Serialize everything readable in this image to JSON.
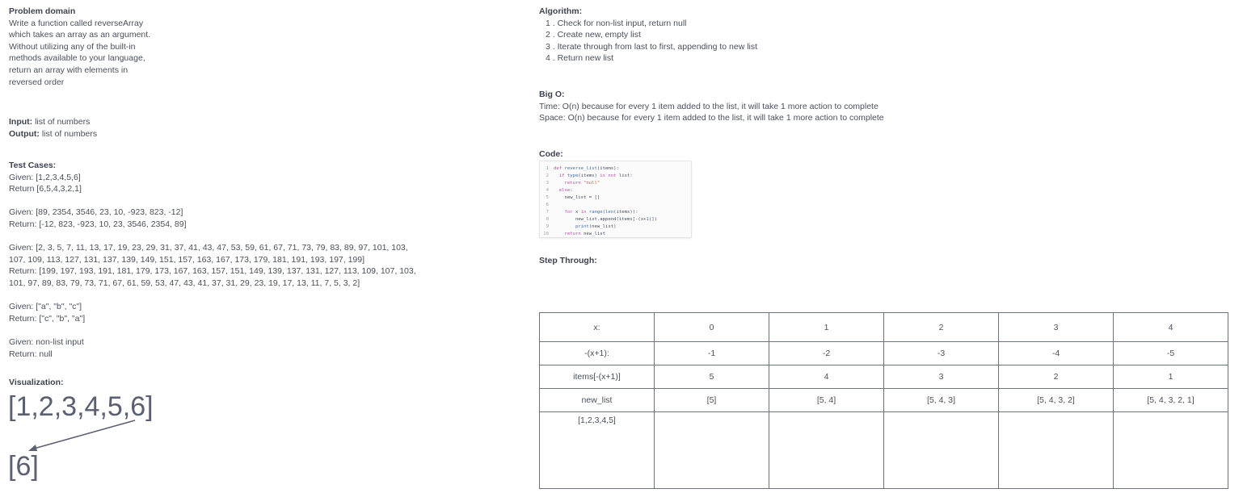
{
  "problem": {
    "heading": "Problem domain",
    "lines": [
      "Write a function called reverseArray",
      "which takes an array as an argument.",
      "Without utilizing any of the built-in",
      "methods available to your language,",
      "return an array with elements in",
      "reversed order"
    ]
  },
  "io": {
    "input_label": "Input:",
    "input_value": "list of numbers",
    "output_label": "Output:",
    "output_value": "list of numbers"
  },
  "tests": {
    "heading": "Test Cases:",
    "lines": [
      "Given: [1,2,3,4,5,6]",
      "Return [6,5,4,3,2,1]",
      "",
      "Given: [89, 2354, 3546, 23, 10, -923, 823, -12]",
      "Return: [-12, 823, -923, 10, 23, 3546, 2354, 89]",
      "",
      "Given: [2, 3, 5, 7, 11, 13, 17, 19, 23, 29, 31, 37, 41, 43, 47, 53, 59, 61, 67, 71, 73, 79, 83, 89, 97, 101, 103,",
      "107, 109, 113, 127, 131, 137, 139, 149, 151, 157, 163, 167, 173, 179, 181, 191, 193, 197, 199]",
      "Return: [199, 197, 193, 191, 181, 179, 173, 167, 163, 157, 151, 149, 139, 137, 131, 127, 113, 109, 107, 103,",
      "101, 97, 89, 83, 79, 73, 71, 67, 61, 59, 53, 47, 43, 41, 37, 31, 29, 23, 19, 17, 13, 11, 7, 5, 3, 2]",
      "",
      "Given: [\"a\", \"b\", \"c\"]",
      "Return: [\"c\", \"b\", \"a\"]",
      "",
      "Given: non-list input",
      "Return: null"
    ]
  },
  "visualization": {
    "heading": "Visualization:",
    "array_text": "[1,2,3,4,5,6]",
    "result_text": "[6]"
  },
  "algorithm": {
    "heading": "Algorithm:",
    "steps": [
      "1 . Check for non-list input, return null",
      "2 . Create new, empty list",
      "3 . Iterate through from last to first, appending to new list",
      "4 . Return new list"
    ]
  },
  "bigo": {
    "heading": "Big O:",
    "time": "Time: O(n) because for every 1 item added to the list, it will take 1 more action to complete",
    "space": "Space: O(n) because for every 1 item added to the list, it will take 1 more action to complete"
  },
  "code": {
    "heading": "Code:",
    "lines": [
      "def reverse_list(items):",
      "  if type(items) is not list:",
      "    return \"null\"",
      "  else:",
      "    new_list = []",
      "",
      "    for x in range(len(items)):",
      "        new_list.append(items[-(x+1)])",
      "        print(new_list)",
      "    return new_list"
    ]
  },
  "step_through": {
    "heading": "Step Through:",
    "rows": [
      [
        "x:",
        "0",
        "1",
        "2",
        "3",
        "4"
      ],
      [
        "-(x+1):",
        "-1",
        "-2",
        "-3",
        "-4",
        "-5"
      ],
      [
        "items[-(x+1)]",
        "5",
        "4",
        "3",
        "2",
        "1"
      ],
      [
        "new_list",
        "[5]",
        "[5, 4]",
        "[5, 4, 3]",
        "[5, 4, 3, 2]",
        "[5, 4, 3, 2, 1]"
      ],
      [
        "[1,2,3,4,5]",
        "",
        "",
        "",
        "",
        ""
      ]
    ]
  }
}
